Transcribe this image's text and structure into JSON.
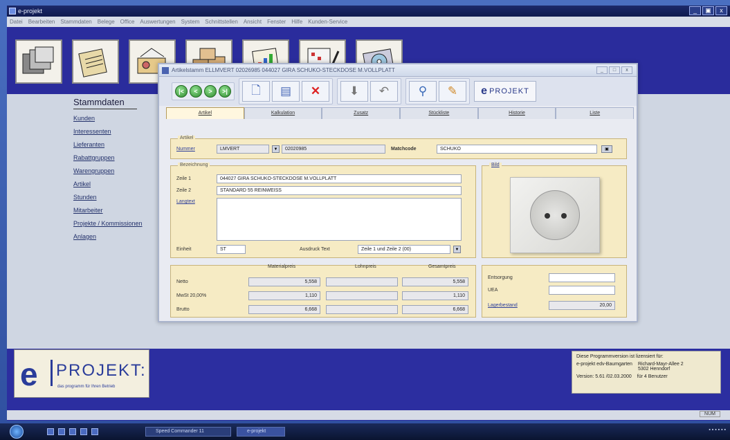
{
  "app": {
    "title": "e-projekt",
    "window_controls": [
      "_",
      "▣",
      "x"
    ],
    "menu": [
      "Datei",
      "Bearbeiten",
      "Stammdaten",
      "Belege",
      "Office",
      "Auswertungen",
      "System",
      "Schnittstellen",
      "Ansicht",
      "Fenster",
      "Hilfe",
      "Kunden-Service"
    ]
  },
  "iconbar": [
    "stammdaten-tool",
    "belege-tool",
    "office-tool",
    "lager-tool",
    "auswertungen-tool",
    "projekte-tool",
    "system-tool"
  ],
  "nav": {
    "title": "Stammdaten",
    "items": [
      "Kunden",
      "Interessenten",
      "Lieferanten",
      "Rabattgruppen",
      "Warengruppen",
      "Artikel",
      "Stunden",
      "Mitarbeiter",
      "Projekte / Kommissionen",
      "Anlagen"
    ]
  },
  "article_window": {
    "title": "Artikelstamm ELLMVERT  02026985  044027 GIRA SCHUKO-STECKDOSE M.VOLLPLATT",
    "controls": [
      "_",
      "□",
      "x"
    ],
    "nav_buttons": [
      "|<",
      "<",
      ">",
      ">|"
    ],
    "toolbar_buttons": [
      "new-doc",
      "form",
      "delete",
      "print",
      "undo",
      "search",
      "tools"
    ],
    "logo_text": "PROJEKT",
    "tabs": [
      "Artikel",
      "Kalkulation",
      "Zusatz",
      "Stückliste",
      "Historie",
      "Liste"
    ],
    "artikel": {
      "legend": "Artikel",
      "nummer_label": "Nummer",
      "lieferant_value": "LMVERT",
      "nummer_value": "02020985",
      "matchcode_label": "Matchcode",
      "matchcode_value": "SCHUKO"
    },
    "bezeichnung": {
      "legend": "Bezeichnung",
      "zeile1_label": "Zeile 1",
      "zeile1_value": "044027 GIRA SCHUKO-STECKDOSE M.VOLLPLATT",
      "zeile2_label": "Zeile 2",
      "zeile2_value": "STANDARD 55 REINWEISS",
      "langtext_label": "Langtext",
      "einheit_label": "Einheit",
      "einheit_value": "ST",
      "ausdruck_label": "Ausdruck Text",
      "ausdruck_value": "Zeile 1 und Zeile 2 (00)"
    },
    "bild": {
      "legend": "Bild"
    },
    "prices": {
      "headers": [
        "Materialpreis",
        "Lohnpreis",
        "Gesamtpreis"
      ],
      "rows": [
        {
          "label": "Netto",
          "material": "5,558",
          "lohn": "",
          "gesamt": "5,558"
        },
        {
          "label": "MwSt 20,00%",
          "material": "1,110",
          "lohn": "",
          "gesamt": "1,110"
        },
        {
          "label": "Brutto",
          "material": "6,668",
          "lohn": "",
          "gesamt": "6,668"
        }
      ]
    },
    "lager": {
      "entsorgung_label": "Entsorgung",
      "uea_label": "UEA",
      "lagerbestand_label": "Lagerbestand",
      "lagerbestand_value": "20,00"
    }
  },
  "brand": {
    "e": "e",
    "name": "PROJEKT:",
    "tagline": "das programm für Ihren Betrieb"
  },
  "license": {
    "line1": "Diese Programmversion ist lizensiert für:",
    "company": "e-projekt edv-Baumgarten",
    "address": "Richard-Mayr-Allee 2\n5302 Henndorf",
    "version": "Version: 5.61 /02.03.2000",
    "users": "für 4 Benutzer"
  },
  "statusbar": {
    "num": "NUM"
  },
  "taskbar": {
    "tasks": [
      "Speed Commander 11",
      "e-projekt"
    ]
  },
  "colors": {
    "desktop": "#3a5aa8",
    "app_body": "#2a2c9c",
    "panel": "#f6ebc4",
    "accent": "#2a3c9a"
  }
}
